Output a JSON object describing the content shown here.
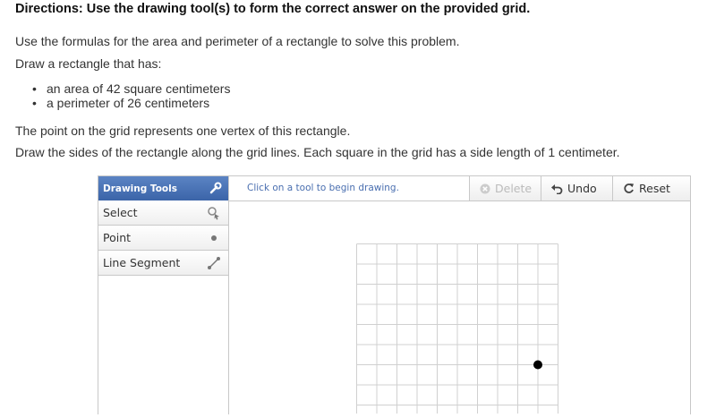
{
  "directions": "Directions: Use the drawing tool(s) to form the correct answer on the provided grid.",
  "paragraphs": {
    "formulas": "Use the formulas for the area and perimeter of a rectangle to solve this problem.",
    "draw": "Draw a rectangle that has:",
    "vertex": "The point on the grid represents one vertex of this rectangle.",
    "sides": "Draw the sides of the rectangle along the grid lines. Each square in the grid has a side length of 1 centimeter."
  },
  "bullets": [
    "an area of 42 square centimeters",
    "a perimeter of 26 centimeters"
  ],
  "tools": {
    "header": "Drawing Tools",
    "items": [
      {
        "label": "Select",
        "icon": "select-pointer-icon"
      },
      {
        "label": "Point",
        "icon": "point-icon"
      },
      {
        "label": "Line Segment",
        "icon": "line-segment-icon"
      }
    ]
  },
  "toolbar": {
    "hint": "Click on a tool to begin drawing.",
    "delete": "Delete",
    "undo": "Undo",
    "reset": "Reset"
  },
  "grid": {
    "columns": 10,
    "rows": 9,
    "vertex": {
      "col": 9,
      "row": 6
    },
    "line_color": "#d0d0d0",
    "point_color": "#000000"
  },
  "colors": {
    "header_bg": "#4a74b8",
    "hint_text": "#4a6fb0",
    "border": "#c8c8c8"
  }
}
